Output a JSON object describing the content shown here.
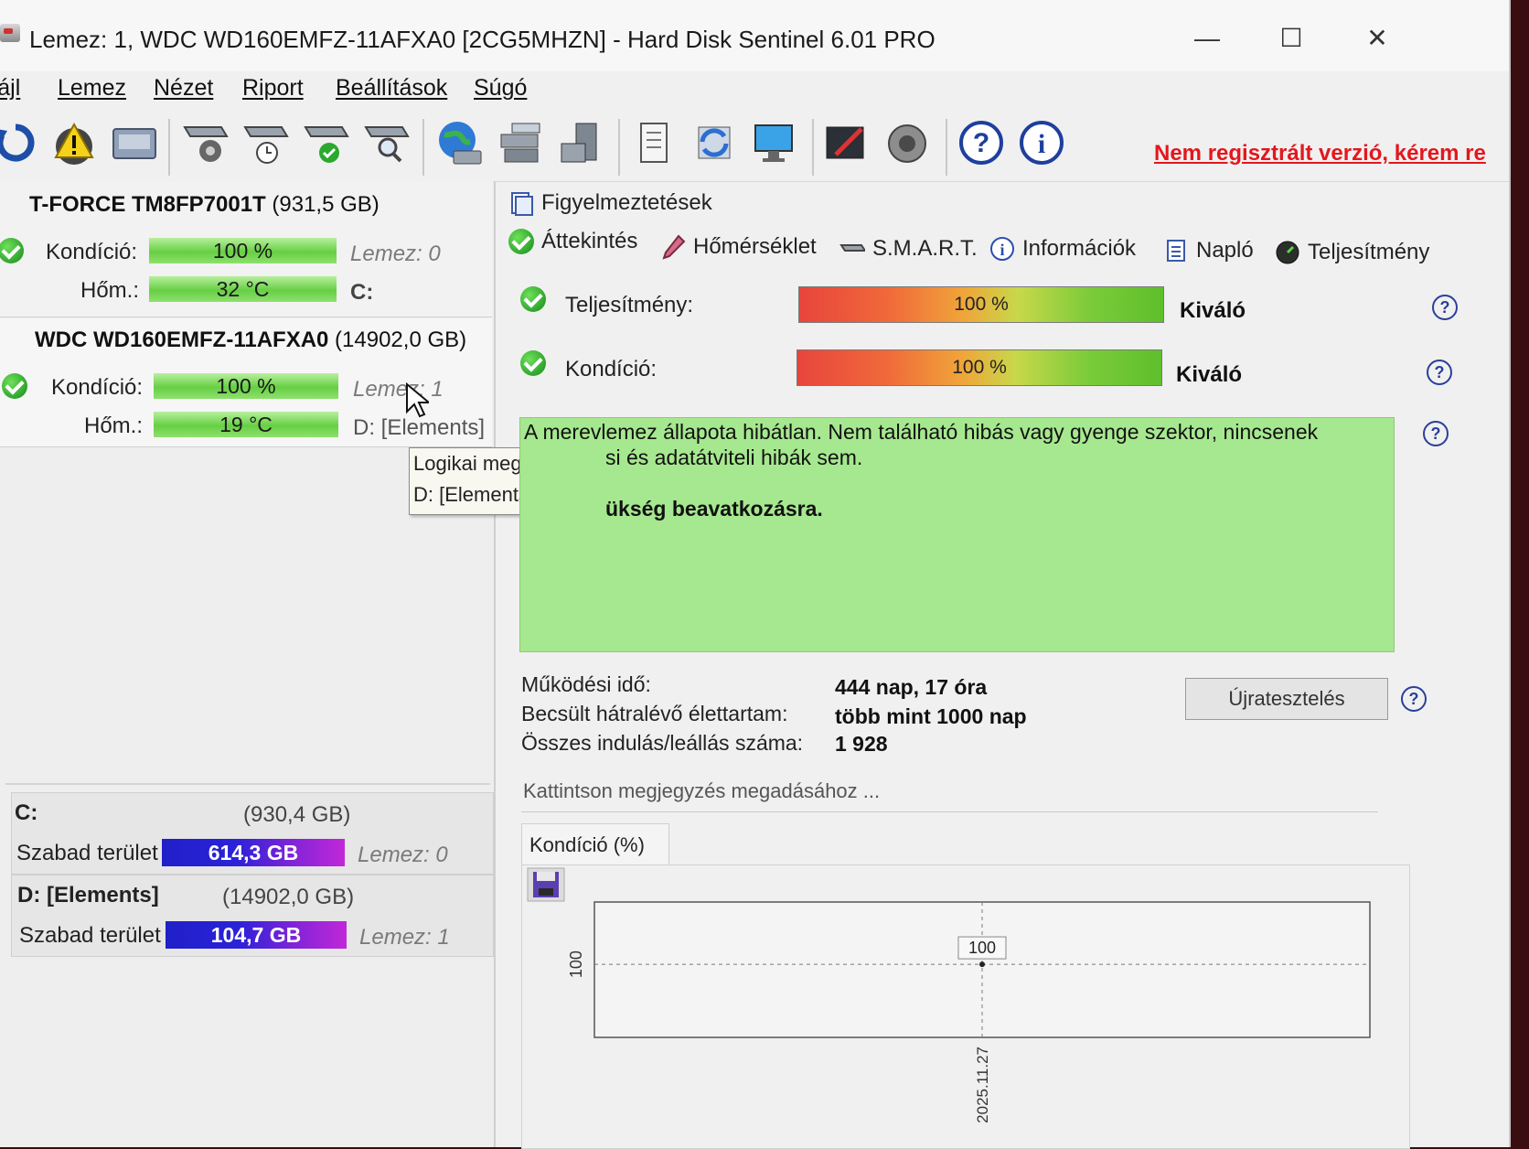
{
  "window": {
    "title": "Lemez: 1, WDC WD160EMFZ-11AFXA0 [2CG5MHZN]  -  Hard Disk Sentinel 6.01 PRO",
    "controls": {
      "minimize": "—",
      "maximize": "☐",
      "close": "✕"
    }
  },
  "menu": [
    "Fájl",
    "Lemez",
    "Nézet",
    "Riport",
    "Beállítások",
    "Súgó"
  ],
  "toolbar": {
    "icons": [
      "refresh-icon",
      "warning-icon",
      "disk-icon",
      "disk-tools-icon",
      "disk-clock-icon",
      "disk-check-icon",
      "disk-search-icon",
      "globe-icon",
      "network-disks-icon",
      "disk-stack-icon",
      "document-icon",
      "sync-icon",
      "monitor-icon",
      "pen-icon",
      "speaker-icon",
      "help-icon",
      "info-icon"
    ],
    "registration_text": "Nem regisztrált verzió, kérem re"
  },
  "disks": [
    {
      "name": "T-FORCE TM8FP7001T",
      "size": "(931,5 GB)",
      "condition_label": "Kondíció:",
      "condition_value": "100 %",
      "temp_label": "Hőm.:",
      "temp_value": "32 °C",
      "disk_index": "Lemez: 0",
      "drive": "C:"
    },
    {
      "name": "WDC WD160EMFZ-11AFXA0",
      "size": "(14902,0 GB)",
      "condition_label": "Kondíció:",
      "condition_value": "100 %",
      "temp_label": "Hőm.:",
      "temp_value": "19 °C",
      "disk_index": "Lemez: 1",
      "drive": "D: [Elements]"
    }
  ],
  "partitions": [
    {
      "name": "C:",
      "size": "(930,4 GB)",
      "free_label": "Szabad terület",
      "free_value": "614,3 GB",
      "disk_index": "Lemez: 0"
    },
    {
      "name": "D: [Elements]",
      "size": "(14902,0 GB)",
      "free_label": "Szabad terület",
      "free_value": "104,7 GB",
      "disk_index": "Lemez: 1"
    }
  ],
  "tooltip": {
    "line1": "Logikai meghajtó(k)",
    "line2": "D: [Elements] NTFS"
  },
  "tabs": {
    "alerts": "Figyelmeztetések",
    "overview": "Áttekintés",
    "temperature": "Hőmérséklet",
    "smart": "S.M.A.R.T.",
    "info": "Információk",
    "log": "Napló",
    "performance": "Teljesítmény"
  },
  "overview": {
    "performance_label": "Teljesítmény:",
    "performance_value": "100 %",
    "performance_rating": "Kiváló",
    "condition_label": "Kondíció:",
    "condition_value": "100 %",
    "condition_rating": "Kiváló",
    "status_line1": "A merevlemez állapota hibátlan. Nem található hibás vagy gyenge szektor, nincsenek",
    "status_line2": "si és adatátviteli hibák sem.",
    "status_line3": "ükség beavatkozásra.",
    "uptime_label": "Működési idő:",
    "uptime_value": "444 nap, 17 óra",
    "lifetime_label": "Becsült hátralévő élettartam:",
    "lifetime_value": "több mint 1000 nap",
    "startstop_label": "Összes indulás/leállás száma:",
    "startstop_value": "1 928",
    "retest_button": "Újratesztelés",
    "note_placeholder": "Kattintson megjegyzés megadásához ..."
  },
  "chart_tab": "Kondíció  (%)",
  "chart_data": {
    "type": "line",
    "title": "",
    "x": [
      "2025.11.27"
    ],
    "series": [
      {
        "values": [
          100
        ]
      }
    ],
    "ylabel": "",
    "yticks": [
      "100"
    ],
    "data_labels": [
      "100"
    ],
    "grid": true
  },
  "colors": {
    "registration": "#e3171d",
    "condition_bar": "#66cf44",
    "free_space_bar_start": "#2020c8",
    "free_space_bar_end": "#c028d8",
    "status_box": "#a6e88f"
  }
}
